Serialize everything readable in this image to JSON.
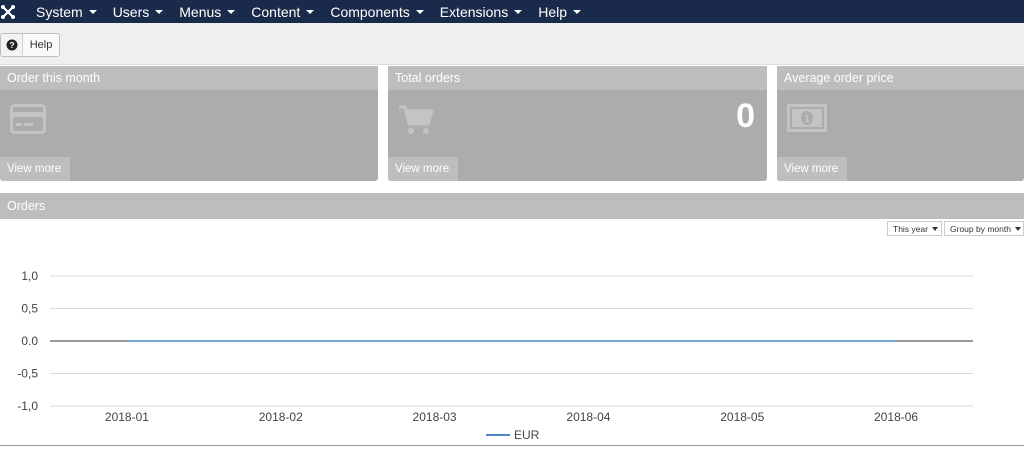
{
  "nav": {
    "items": [
      {
        "label": "System"
      },
      {
        "label": "Users"
      },
      {
        "label": "Menus"
      },
      {
        "label": "Content"
      },
      {
        "label": "Components"
      },
      {
        "label": "Extensions"
      },
      {
        "label": "Help"
      }
    ]
  },
  "toolbar": {
    "help_label": "Help"
  },
  "panels": {
    "order_month": {
      "title": "Order this month",
      "view_more": "View more"
    },
    "total_orders": {
      "title": "Total orders",
      "value": "0",
      "view_more": "View more"
    },
    "avg_price": {
      "title": "Average order price",
      "view_more": "View more"
    }
  },
  "orders": {
    "title": "Orders",
    "period_select": "This year",
    "group_select": "Group by month"
  },
  "colors": {
    "navbar": "#1a2a4a",
    "panel_body": "#acacac",
    "panel_header": "#bdbdbd",
    "series_line": "#4a86c8"
  },
  "chart_data": {
    "type": "line",
    "categories": [
      "2018-01",
      "2018-02",
      "2018-03",
      "2018-04",
      "2018-05",
      "2018-06"
    ],
    "series": [
      {
        "name": "EUR",
        "values": [
          0,
          0,
          0,
          0,
          0,
          0
        ]
      }
    ],
    "ylim": [
      -1,
      1
    ],
    "yticks": [
      1,
      0.5,
      0,
      -0.5,
      -1
    ],
    "ytick_labels": [
      "1,0",
      "0,5",
      "0.0",
      "-0,5",
      "-1,0"
    ],
    "grid": true,
    "legend": "bottom-center"
  }
}
